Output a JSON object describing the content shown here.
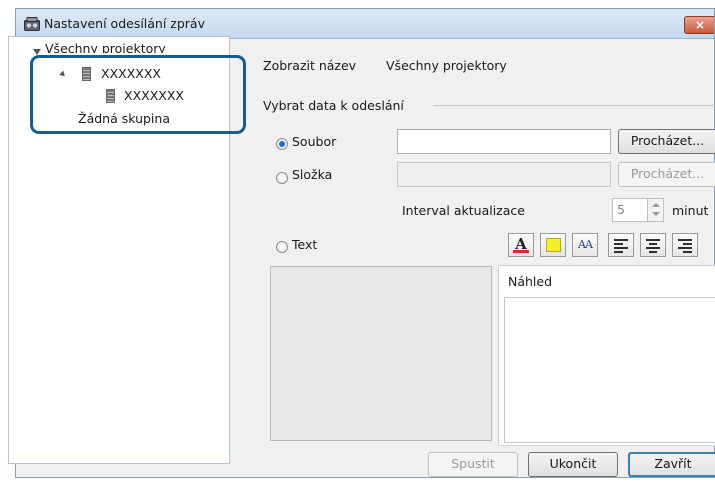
{
  "window": {
    "title": "Nastavení odesílání zpráv",
    "close_label": "×"
  },
  "tree": {
    "root_label": "Všechny projektory",
    "group_label": "XXXXXXX",
    "child_label": "XXXXXXX",
    "no_group_label": "Žádná skupina"
  },
  "header": {
    "show_name_label": "Zobrazit název",
    "show_name_value": "Všechny projektory"
  },
  "data_group": {
    "title": "Vybrat data k odeslání",
    "file_label": "Soubor",
    "file_value": "",
    "file_browse": "Procházet...",
    "folder_label": "Složka",
    "folder_value": "",
    "folder_browse": "Procházet...",
    "interval_label": "Interval aktualizace",
    "interval_value": "5",
    "interval_unit": "minut",
    "text_label": "Text",
    "text_value": "",
    "preview_label": "Náhled"
  },
  "format_toolbar": {
    "font_color_glyph": "A",
    "font_size_glyph": "AA"
  },
  "footer": {
    "start_label": "Spustit",
    "stop_label": "Ukončit",
    "close_label": "Zavřít"
  },
  "colors": {
    "highlight_border": "#1d5a8c",
    "radio_selected": "#2d6cc0",
    "font_color_swatch": "#d62b2b",
    "background_color_swatch": "#f2ef2b"
  },
  "icons": {
    "title": "projector-network-icon",
    "tree_items": "projector-icon"
  }
}
